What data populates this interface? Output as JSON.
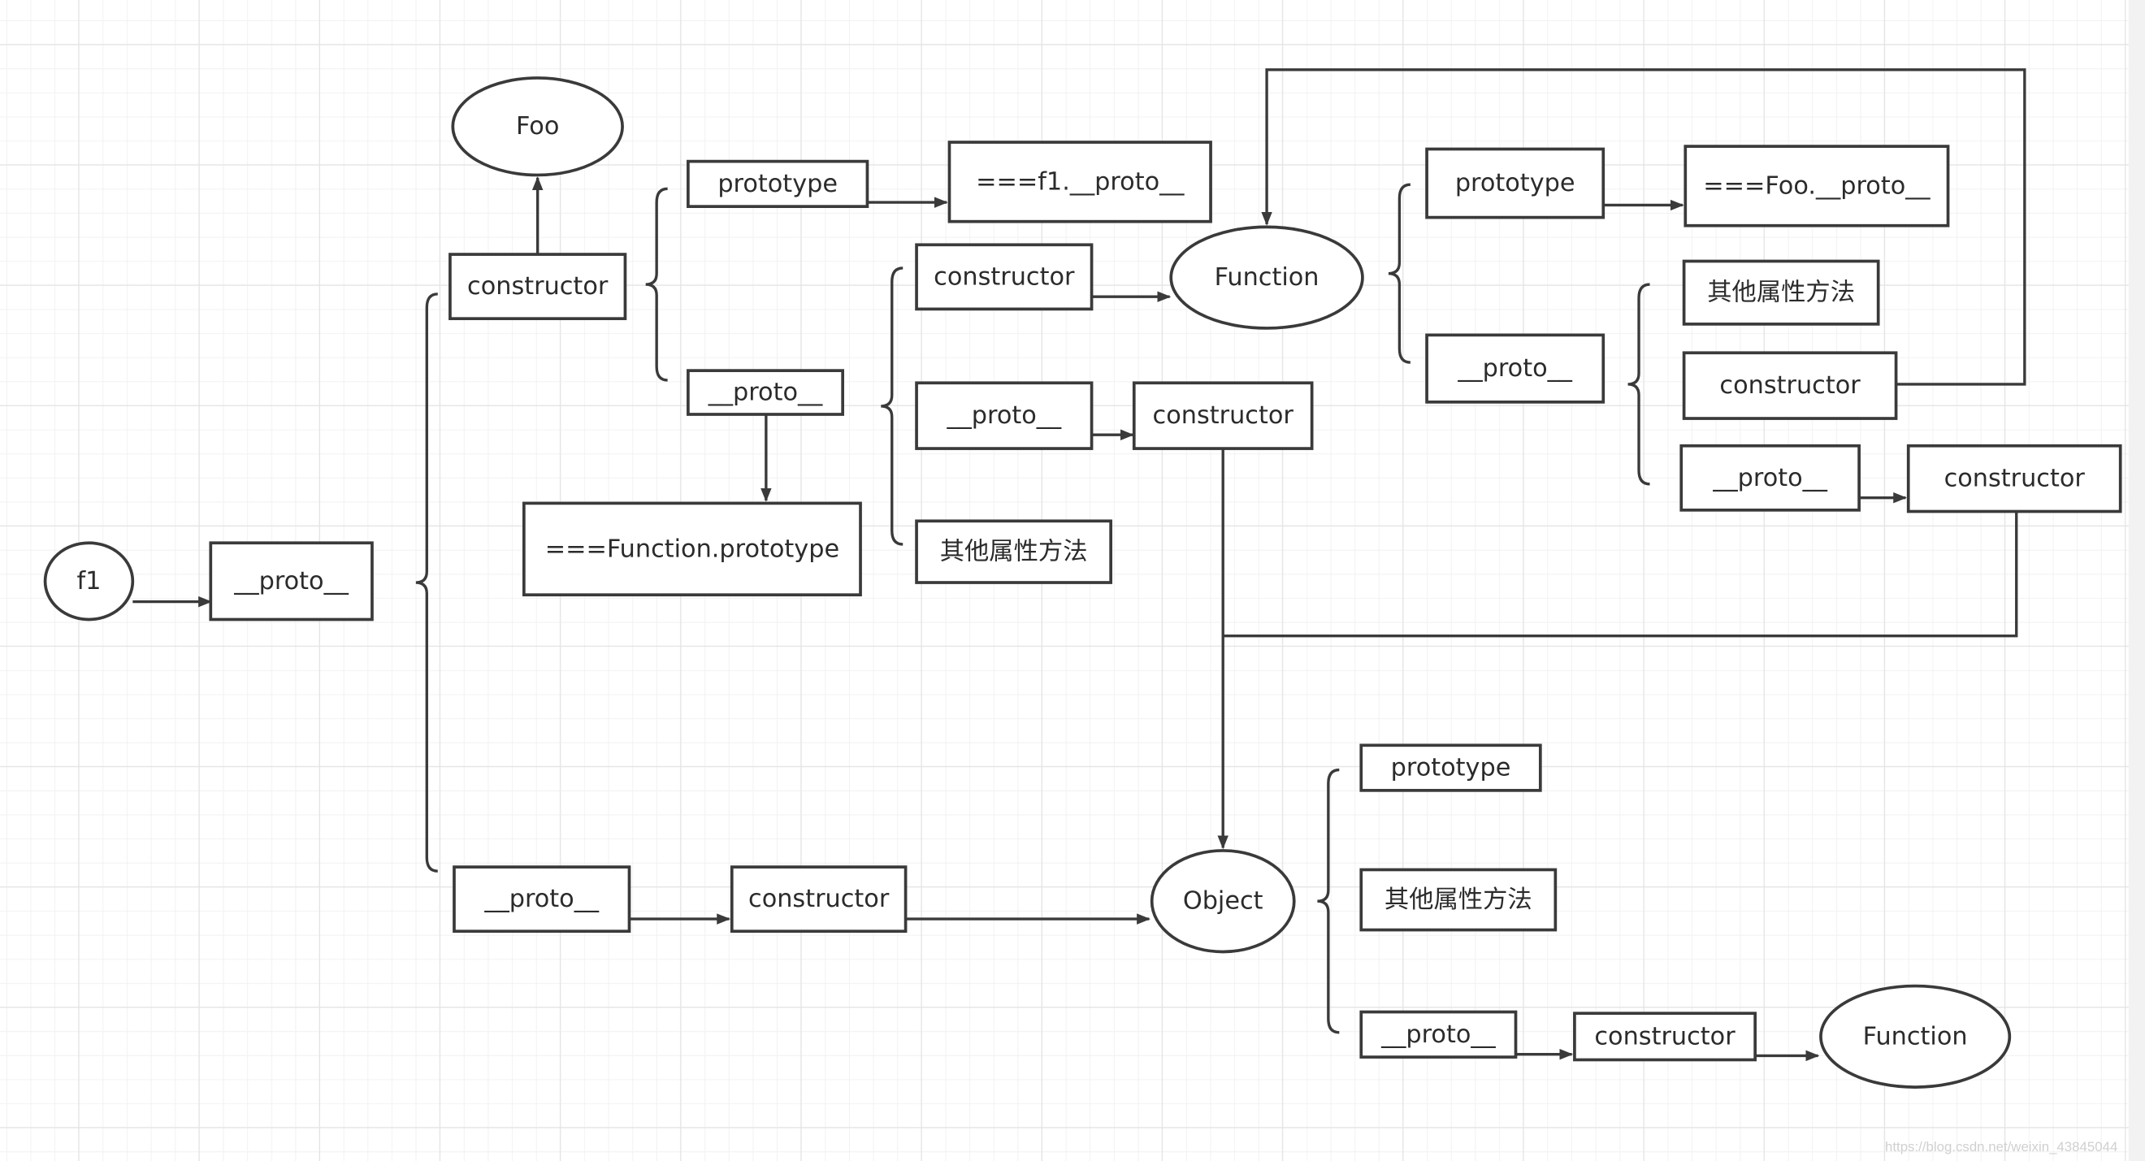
{
  "nodes": [
    {
      "id": "f1",
      "label": "f1",
      "shape": "ellipse"
    },
    {
      "id": "f1-proto",
      "label": "__proto__",
      "shape": "box"
    },
    {
      "id": "foo",
      "label": "Foo",
      "shape": "ellipse"
    },
    {
      "id": "foo-constructor",
      "label": "constructor",
      "shape": "box"
    },
    {
      "id": "foo-prototype",
      "label": "prototype",
      "shape": "box"
    },
    {
      "id": "eq-f1-proto",
      "label": "===f1.__proto__",
      "shape": "box"
    },
    {
      "id": "foo-proto",
      "label": "__proto__",
      "shape": "box"
    },
    {
      "id": "eq-function-prototype",
      "label": "===Function.prototype",
      "shape": "box"
    },
    {
      "id": "fp-constructor",
      "label": "constructor",
      "shape": "box"
    },
    {
      "id": "fp-proto",
      "label": "__proto__",
      "shape": "box"
    },
    {
      "id": "fp-proto-constructor",
      "label": "constructor",
      "shape": "box"
    },
    {
      "id": "fp-other",
      "label": "其他属性方法",
      "shape": "box"
    },
    {
      "id": "function",
      "label": "Function",
      "shape": "ellipse"
    },
    {
      "id": "function-prototype",
      "label": "prototype",
      "shape": "box"
    },
    {
      "id": "eq-foo-proto",
      "label": "===Foo.__proto__",
      "shape": "box"
    },
    {
      "id": "function-proto",
      "label": "__proto__",
      "shape": "box"
    },
    {
      "id": "ffp-other",
      "label": "其他属性方法",
      "shape": "box"
    },
    {
      "id": "ffp-constructor",
      "label": "constructor",
      "shape": "box"
    },
    {
      "id": "ffp-proto",
      "label": "__proto__",
      "shape": "box"
    },
    {
      "id": "ffp-proto-constructor",
      "label": "constructor",
      "shape": "box"
    },
    {
      "id": "fooproto-proto",
      "label": "__proto__",
      "shape": "box"
    },
    {
      "id": "fooproto-proto-constructor",
      "label": "constructor",
      "shape": "box"
    },
    {
      "id": "object",
      "label": "Object",
      "shape": "ellipse"
    },
    {
      "id": "object-prototype",
      "label": "prototype",
      "shape": "box"
    },
    {
      "id": "object-other",
      "label": "其他属性方法",
      "shape": "box"
    },
    {
      "id": "object-proto",
      "label": "__proto__",
      "shape": "box"
    },
    {
      "id": "object-proto-constructor",
      "label": "constructor",
      "shape": "box"
    },
    {
      "id": "function-2",
      "label": "Function",
      "shape": "ellipse"
    }
  ],
  "watermark": "https://blog.csdn.net/weixin_43845044"
}
